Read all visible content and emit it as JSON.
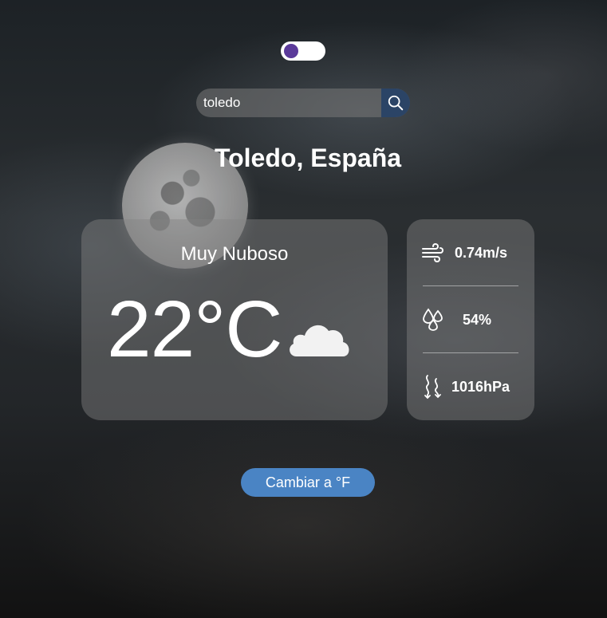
{
  "theme_toggle": {
    "state": "on"
  },
  "search": {
    "value": "toledo",
    "placeholder": ""
  },
  "location": {
    "city": "Toledo, España"
  },
  "weather": {
    "condition": "Muy Nuboso",
    "temperature": "22°C",
    "icon": "cloud-icon",
    "moon_icon": "moon-icon"
  },
  "stats": {
    "wind": {
      "icon": "wind-icon",
      "value": "0.74m/s"
    },
    "humidity": {
      "icon": "humidity-icon",
      "value": "54%"
    },
    "pressure": {
      "icon": "pressure-icon",
      "value": "1016hPa"
    }
  },
  "unit_button": {
    "label": "Cambiar a °F"
  },
  "colors": {
    "toggle_knob": "#5b3a9a",
    "search_button": "#2b4466",
    "unit_button": "#4a84c4"
  }
}
